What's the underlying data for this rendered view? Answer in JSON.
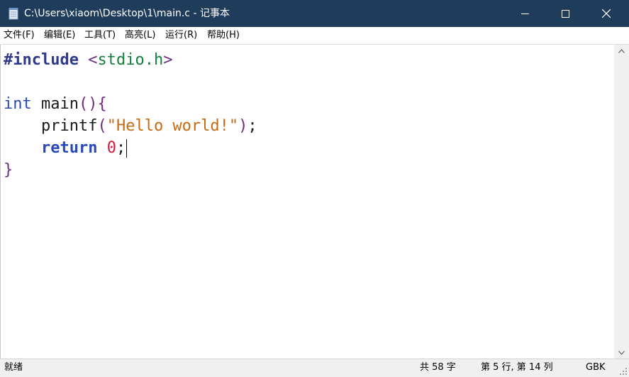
{
  "window": {
    "title": "C:\\Users\\xiaom\\Desktop\\1\\main.c - 记事本",
    "icon": "notepad-icon",
    "controls": [
      "minimize-icon",
      "maximize-icon",
      "close-icon"
    ]
  },
  "menu": {
    "items": [
      {
        "label": "文件(F)"
      },
      {
        "label": "编辑(E)"
      },
      {
        "label": "工具(T)"
      },
      {
        "label": "高亮(L)"
      },
      {
        "label": "运行(R)"
      },
      {
        "label": "帮助(H)"
      }
    ]
  },
  "editor": {
    "lines": [
      {
        "preproc": "#include",
        "open": "<",
        "file": "stdio.h",
        "close": ">"
      },
      {
        "text": ""
      },
      {
        "type": "int",
        "name": " main",
        "parens": "()",
        "brace": "{"
      },
      {
        "indent": "    ",
        "func": "printf",
        "open": "(",
        "str": "\"Hello world!\"",
        "close": ")",
        "semi": ";"
      },
      {
        "indent": "    ",
        "kw": "return",
        "space": " ",
        "num": "0",
        "semi": ";"
      },
      {
        "brace": "}"
      }
    ]
  },
  "status": {
    "state": "就绪",
    "chars": "共 58 字",
    "position": "第 5 行, 第 14 列",
    "encoding": "GBK"
  },
  "colors": {
    "titlebar": "#1f3c5a",
    "preprocessor": "#2e3a8c",
    "keyword": "#2a49b8",
    "string": "#c86a12",
    "number": "#d01a3a",
    "include_file": "#16803c",
    "punctuation": "#6d2d7e"
  }
}
